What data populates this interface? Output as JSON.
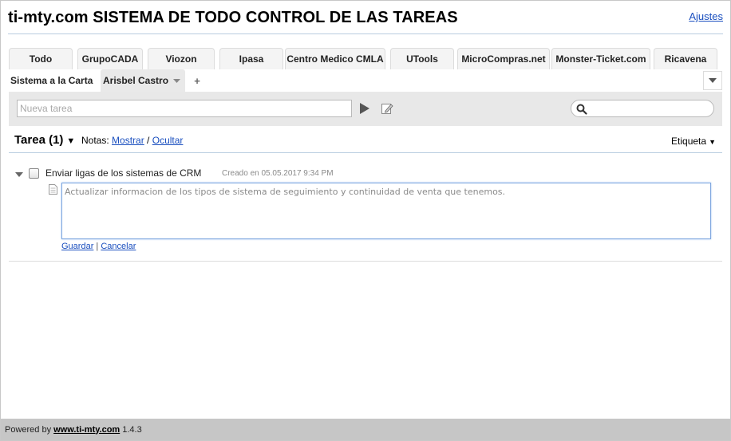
{
  "header": {
    "title": "ti-mty.com SISTEMA DE TODO CONTROL DE LAS TAREAS",
    "settings_label": "Ajustes"
  },
  "tabs_row1": [
    "Todo",
    "GrupoCADA",
    "Viozon",
    "Ipasa",
    "Centro Medico CMLA",
    "UTools",
    "MicroCompras.net",
    "Monster-Ticket.com",
    "Ricavena"
  ],
  "tabs_row2": {
    "items": [
      "Sistema a la Carta",
      "Arisbel Castro"
    ],
    "add_label": "+"
  },
  "toolbar": {
    "new_task_placeholder": "Nueva tarea",
    "search_value": ""
  },
  "list": {
    "title": "Tarea (1)",
    "notes_label": "Notas:",
    "show_label": "Mostrar",
    "separator": "/",
    "hide_label": "Ocultar",
    "tag_label": "Etiqueta"
  },
  "task": {
    "title": "Enviar ligas de los sistemas de CRM",
    "created": "Creado en 05.05.2017 9:34 PM",
    "note": "Actualizar informacion de los tipos de sistema de seguimiento y continuidad de venta que tenemos.",
    "save_label": "Guardar",
    "action_separator": "|",
    "cancel_label": "Cancelar"
  },
  "footer": {
    "powered_label": "Powered by",
    "link_label": "www.ti-mty.com",
    "version": "1.4.3"
  },
  "icons": [
    "play-icon",
    "edit-note-icon",
    "search-icon",
    "chevron-down-icon",
    "plus-icon",
    "note-icon",
    "expand-arrow-icon"
  ]
}
